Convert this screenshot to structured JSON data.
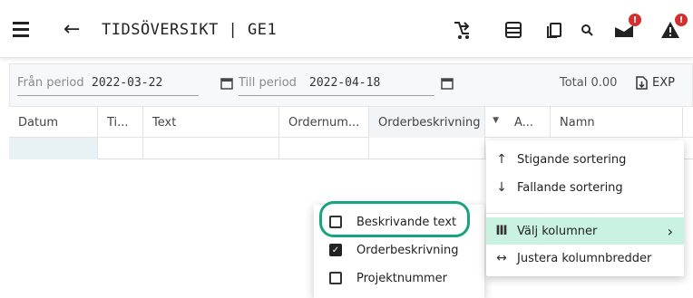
{
  "header": {
    "title": "TIDSÖVERSIKT | GE1",
    "icons": [
      "hamburger-icon",
      "back-arrow-icon",
      "branch-icon",
      "calculator-icon",
      "copy-icon",
      "search-icon",
      "mail-icon",
      "alert-icon"
    ],
    "badge_mail": "!",
    "badge_alert": "!",
    "accent_color": "#d32f2f"
  },
  "filters": {
    "from_label": "Från period",
    "from_value": "2022-03-22",
    "to_label": "Till period",
    "to_value": "2022-04-18",
    "total": "Total 0.00",
    "export_label": "EXP"
  },
  "grid": {
    "columns": [
      "Datum",
      "Ti...",
      "Text",
      "Ordernum...",
      "Orderbeskrivning",
      "A...",
      "Namn"
    ]
  },
  "context_menu": {
    "items": [
      {
        "icon": "↑",
        "label": "Stigande sortering"
      },
      {
        "icon": "↓",
        "label": "Fallande sortering"
      },
      {
        "icon": "Ⅲ",
        "label": "Välj kolumner",
        "chevron": "›"
      },
      {
        "icon": "↔",
        "label": "Justera kolumnbredder"
      }
    ]
  },
  "column_chooser": {
    "items": [
      {
        "label": "Beskrivande text",
        "checked": false
      },
      {
        "label": "Orderbeskrivning",
        "checked": true
      },
      {
        "label": "Projektnummer",
        "checked": false
      }
    ],
    "highlight_color": "#1aa382"
  }
}
